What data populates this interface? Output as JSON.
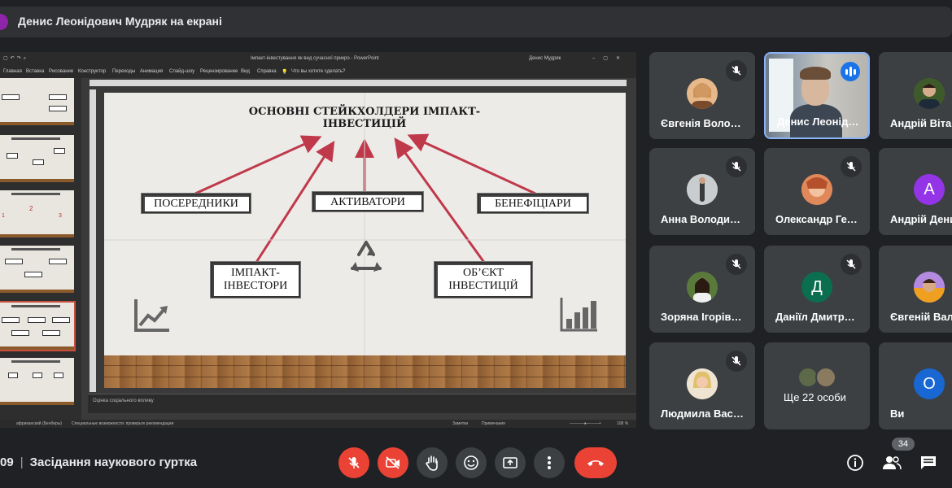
{
  "presenter_bar": {
    "title": "Денис Леонідович Мудряк на екрані"
  },
  "ppt": {
    "doc_title": "Імпакт-інвестування як вид сучасної прикро - PowerPoint",
    "user": "Денис Мудряк",
    "search_hint": "Что вы хотите сделать?",
    "ribbon_tabs": [
      "Главная",
      "Вставка",
      "Рисование",
      "Конструктор",
      "Переходы",
      "Анимация",
      "Слайд-шоу",
      "Рецензирование",
      "Вид",
      "Справка"
    ],
    "notes_text": "Оцінка соціального впливу",
    "status_left": "африканский (Бенберы)",
    "status_accessibility": "Специальные возможности: проверьте рекомендации",
    "status_notes": "Заметки",
    "status_comments": "Примечания",
    "zoom": "108 %"
  },
  "slide": {
    "title": "ОСНОВНІ СТЕЙКХОЛДЕРИ ІМПАКТ-ІНВЕСТИЦІЙ",
    "boxes": {
      "intermediaries": "ПОСЕРЕДНИКИ",
      "activators": "АКТИВАТОРИ",
      "beneficiaries": "БЕНЕФІЦІАРИ",
      "investors": "ІМПАКТ-ІНВЕСТОРИ",
      "object": "ОБ’ЄКТ ІНВЕСТИЦІЙ"
    },
    "thumb_numbers": [
      "1",
      "2",
      "3"
    ]
  },
  "participants": [
    {
      "name": "Євгенія Воло…",
      "muted": true
    },
    {
      "name": "Денис Леонід…",
      "speaking": true
    },
    {
      "name": "Андрій Віта…",
      "muted": false
    },
    {
      "name": "Анна Володи…",
      "muted": true
    },
    {
      "name": "Олександр Ге…",
      "muted": true
    },
    {
      "name": "Андрій Дени…",
      "initial": "А",
      "muted": false
    },
    {
      "name": "Зоряна Ігорів…",
      "muted": true
    },
    {
      "name": "Даніїл Дмитр…",
      "initial": "Д",
      "muted": true
    },
    {
      "name": "Євгеній Вал…",
      "muted": false
    },
    {
      "name": "Людмила Вас…",
      "muted": true
    },
    {
      "name": "Ще 22 особи"
    },
    {
      "name": "Ви",
      "initial": "О"
    }
  ],
  "bottom": {
    "time": "09",
    "meeting_title": "Засідання наукового гуртка",
    "participants_count": "34"
  },
  "colors": {
    "accent_blue": "#1a73e8",
    "danger_red": "#ea4335",
    "arrow_red": "#c0394b",
    "tile_bg": "#3c4043"
  }
}
